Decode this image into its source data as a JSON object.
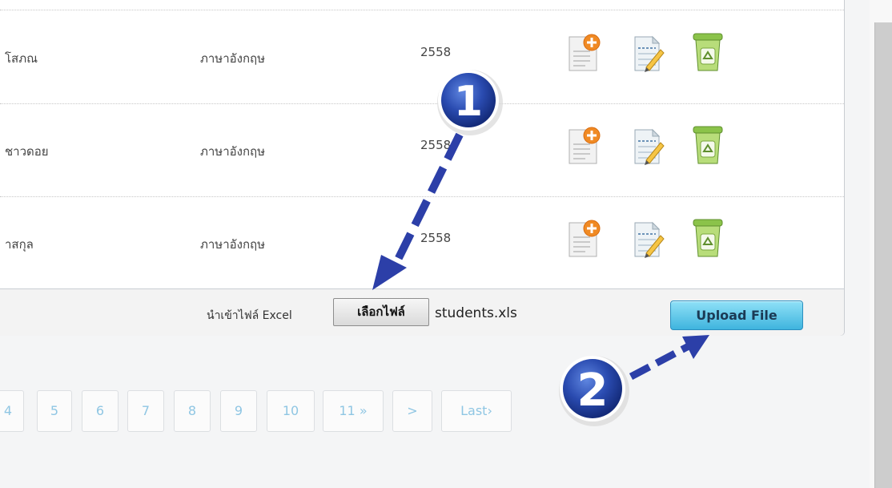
{
  "table": {
    "rows": [
      {
        "name": "โสภณ",
        "subject": "ภาษาอังกฤษ",
        "year": "2558"
      },
      {
        "name": "ชาวดอย",
        "subject": "ภาษาอังกฤษ",
        "year": "2558"
      },
      {
        "name": "าสกุล",
        "subject": "ภาษาอังกฤษ",
        "year": "2558"
      }
    ],
    "row_icons": [
      "add-document-icon",
      "edit-document-icon",
      "recycle-bin-icon"
    ]
  },
  "import": {
    "label": "นำเข้าไฟล์ Excel",
    "choose_button": "เลือกไฟล์",
    "file_name": "students.xls",
    "upload_button": "Upload File"
  },
  "pagination": {
    "pages": [
      "4",
      "5",
      "6",
      "7",
      "8",
      "9",
      "10",
      "11 »",
      ">",
      "Last›"
    ]
  },
  "annotations": {
    "step1": "1",
    "step2": "2"
  },
  "colors": {
    "upload_accent": "#3fb4de",
    "badge_blue": "#1f3f9a",
    "arrow_blue": "#2c3fa8",
    "pager_text": "#8fc6e3"
  }
}
